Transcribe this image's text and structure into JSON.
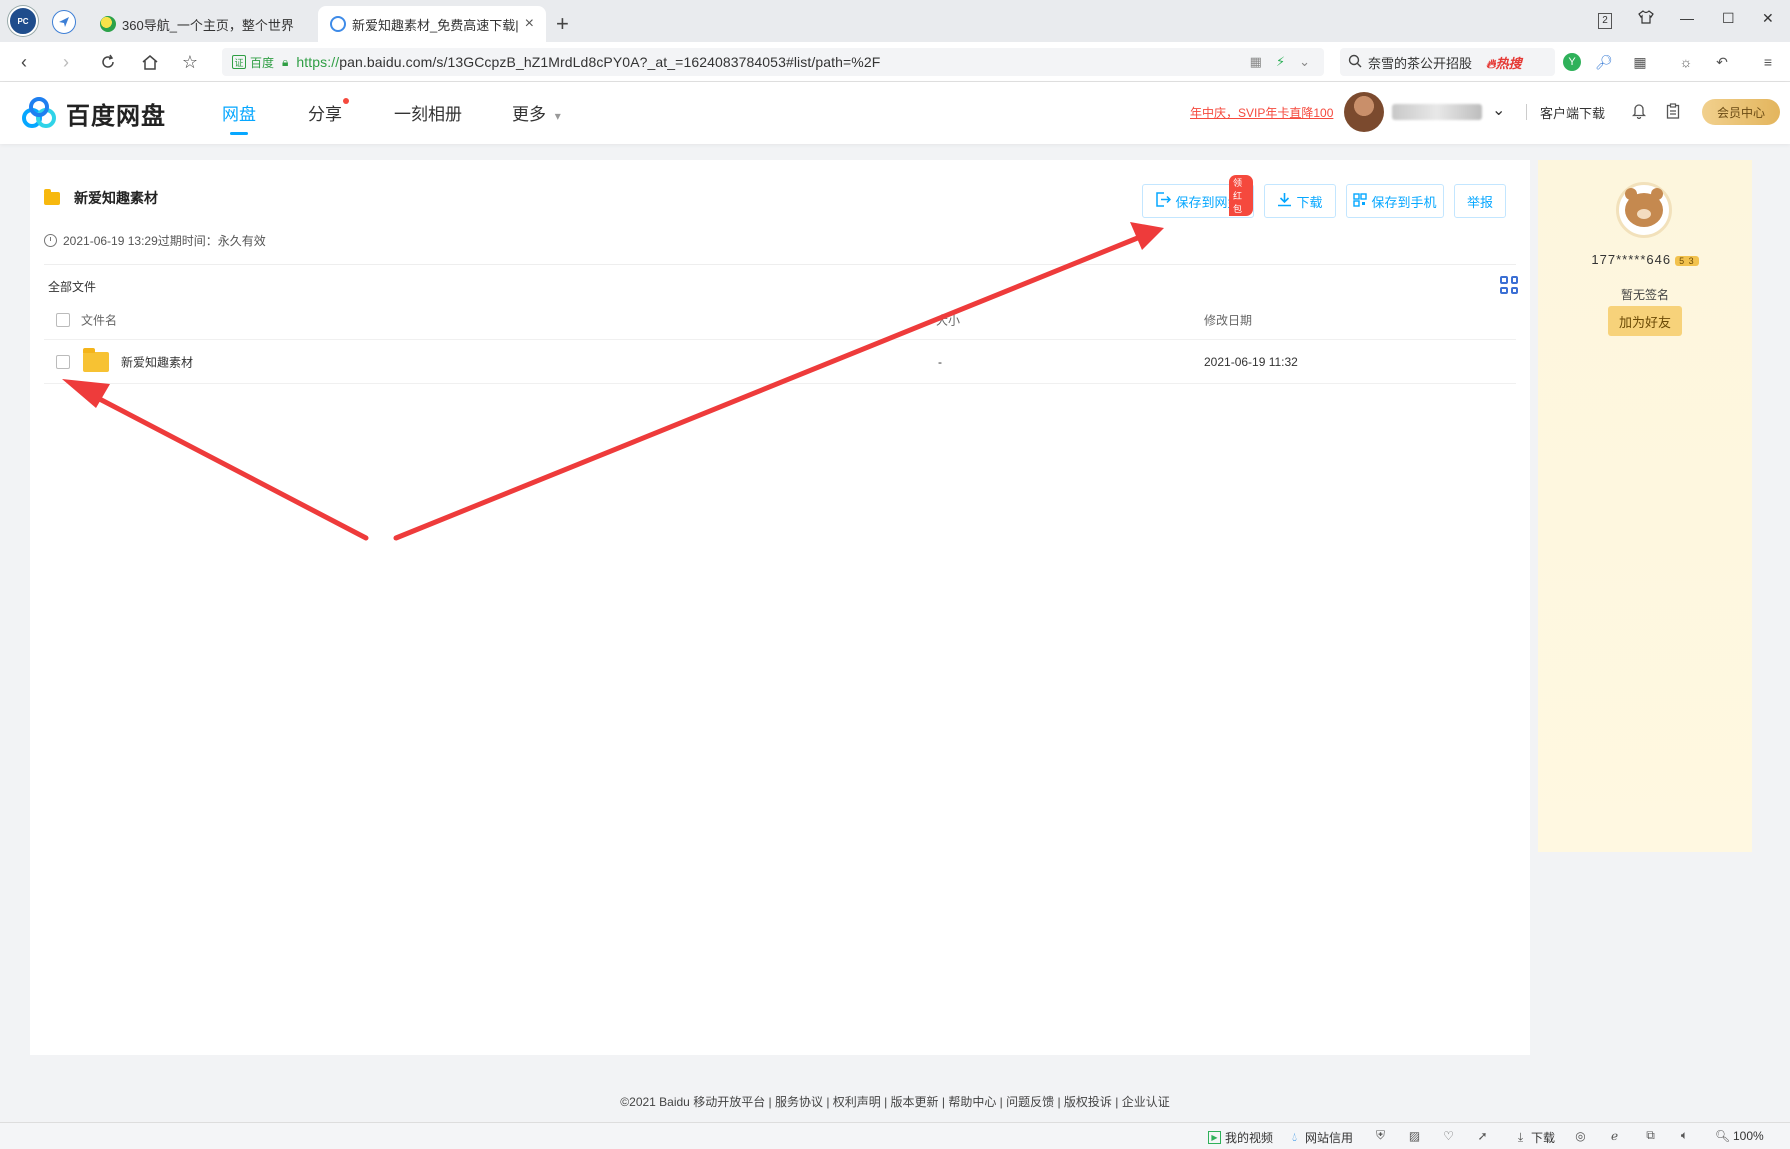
{
  "browser": {
    "tabs": [
      {
        "title": "360导航_一个主页，整个世界",
        "active": false
      },
      {
        "title": "新爱知趣素材_免费高速下载|百度",
        "active": true
      }
    ],
    "new_tab": "+",
    "url": {
      "cert_label": "百度",
      "cert_badge": "证",
      "protocol": "https://",
      "rest": "pan.baidu.com/s/13GCcpzB_hZ1MrdLd8cPY0A?_at_=1624083784053#list/path=%2F"
    },
    "search": {
      "text": "奈雪的茶公开招股",
      "hot": "热搜"
    },
    "window_badge": "2"
  },
  "header": {
    "logo": "百度网盘",
    "nav": [
      {
        "label": "网盘",
        "active": true
      },
      {
        "label": "分享",
        "dot": true
      },
      {
        "label": "一刻相册"
      },
      {
        "label": "更多"
      }
    ],
    "promo": "年中庆，SVIP年卡直降100",
    "client_download": "客户端下载",
    "vip_center": "会员中心"
  },
  "share": {
    "folder_name": "新爱知趣素材",
    "created": "2021-06-19 13:29",
    "expire_label": "过期时间：",
    "expire_value": "永久有效",
    "buttons": {
      "save": "保存到网盘",
      "save_badge": "领红包",
      "download": "下载",
      "save_phone": "保存到手机",
      "report": "举报"
    },
    "breadcrumb": "全部文件",
    "columns": {
      "name": "文件名",
      "size": "大小",
      "date": "修改日期"
    },
    "rows": [
      {
        "name": "新爱知趣素材",
        "size": "-",
        "date": "2021-06-19 11:32"
      }
    ]
  },
  "sharer": {
    "uid": "177*****646",
    "level": "5 3",
    "signature": "暂无签名",
    "add_friend": "加为好友"
  },
  "footer": "©2021 Baidu  移动开放平台 | 服务协议 | 权利声明 | 版本更新 | 帮助中心 | 问题反馈 | 版权投诉 | 企业认证",
  "statusbar": {
    "video": "我的视频",
    "credit": "网站信用",
    "download": "下载",
    "zoom": "100%"
  },
  "colors": {
    "accent": "#06a7ff",
    "annotation": "#ee3b3b",
    "folder": "#f7c233"
  }
}
